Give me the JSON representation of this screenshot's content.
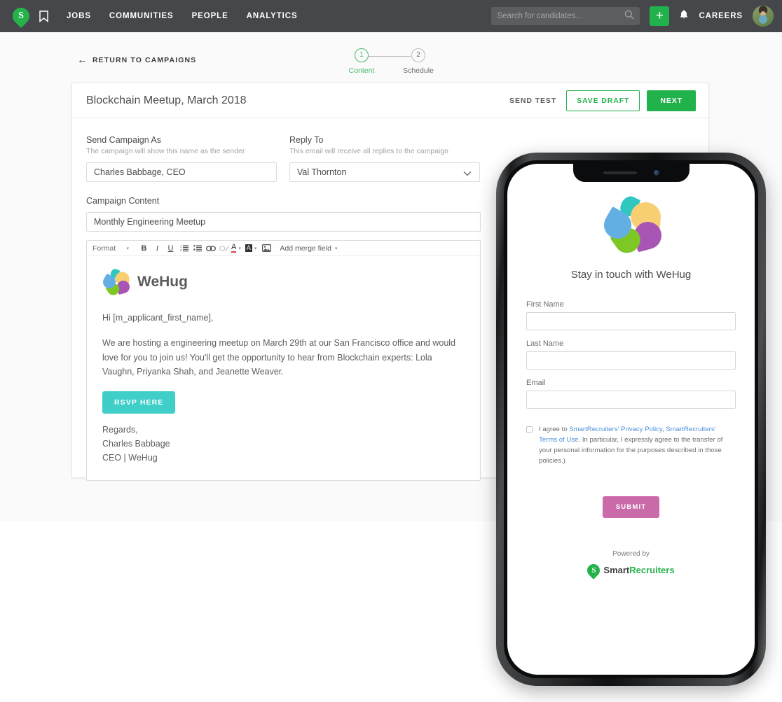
{
  "topnav": {
    "logo_icon": "smartrecruiters-pin-icon",
    "logo_letter": "S",
    "bookmark_icon": "bookmark-icon",
    "links": [
      {
        "label": "JOBS"
      },
      {
        "label": "COMMUNITIES"
      },
      {
        "label": "PEOPLE"
      },
      {
        "label": "ANALYTICS"
      }
    ],
    "search": {
      "placeholder": "Search for candidates...",
      "value": "",
      "icon": "search-icon"
    },
    "add_button_label": "+",
    "bell_icon": "notification-bell-icon",
    "careers_label": "CAREERS",
    "avatar_name": "user-avatar"
  },
  "page": {
    "return_link": "RETURN TO CAMPAIGNS",
    "return_arrow": "←",
    "stepper": [
      {
        "number": "1",
        "label": "Content",
        "active": true
      },
      {
        "number": "2",
        "label": "Schedule",
        "active": false
      }
    ]
  },
  "card": {
    "title": "Blockchain Meetup, March 2018",
    "send_test_label": "SEND TEST",
    "save_draft_label": "SAVE DRAFT",
    "next_label": "NEXT",
    "send_as": {
      "label": "Send Campaign As",
      "hint": "The campaign will show this name as the sender",
      "value": "Charles Babbage, CEO",
      "placeholder": ""
    },
    "reply_to": {
      "label": "Reply To",
      "hint": "This email will receive all replies to the campaign",
      "value": "Val Thornton",
      "chevron_icon": "chevron-down-icon"
    },
    "campaign_content": {
      "label": "Campaign Content",
      "value": "Monthly Engineering Meetup",
      "placeholder": ""
    }
  },
  "toolbar": {
    "format_label": "Format",
    "format_caret": "▾",
    "bold": "B",
    "italic": "I",
    "underline": "U",
    "ordered_list_icon": "ordered-list-icon",
    "unordered_list_icon": "unordered-list-icon",
    "link_icon": "link-icon",
    "unlink_icon": "unlink-icon",
    "text_color_glyph": "A",
    "bg_color_glyph": "A",
    "image_icon": "insert-image-icon",
    "merge_field_label": "Add merge field",
    "merge_caret": "▾"
  },
  "email": {
    "brand_name": "WeHug",
    "greeting": "Hi [m_applicant_first_name],",
    "paragraph": "We are hosting a engineering meetup on March 29th at our San Francisco office and would love for you to join us! You'll get the opportunity to hear from Blockchain experts: Lola Vaughn, Priyanka Shah, and Jeanette Weaver.",
    "cta_label": "RSVP HERE",
    "sig_line1": "Regards,",
    "sig_line2": "Charles Babbage",
    "sig_line3": "CEO | WeHug"
  },
  "phone": {
    "title": "Stay in touch with WeHug",
    "fields": [
      {
        "label": "First Name",
        "value": "",
        "name": "first-name-input"
      },
      {
        "label": "Last Name",
        "value": "",
        "name": "last-name-input"
      },
      {
        "label": "Email",
        "value": "",
        "name": "email-input"
      }
    ],
    "consent": {
      "prefix": "I agree to ",
      "link1": "SmartRecruiters' Privacy Policy",
      "mid": ", ",
      "link2": "SmartRecruiters' Terms of Use",
      "suffix": ". In particular, I expressly agree to the transfer of your personal information for the purposes described in those policies.)"
    },
    "submit_label": "SUBMIT",
    "powered_by": "Powered by",
    "sr_word_dark": "Smart",
    "sr_word_green": "Recruiters",
    "sr_letter": "S"
  },
  "colors": {
    "brand_green": "#22b24c",
    "nav_bg": "#45474a",
    "accent_teal": "#3fcfc8",
    "accent_pink": "#cb6aa8",
    "link_blue": "#4a90d9",
    "page_bg": "#fafafa"
  }
}
